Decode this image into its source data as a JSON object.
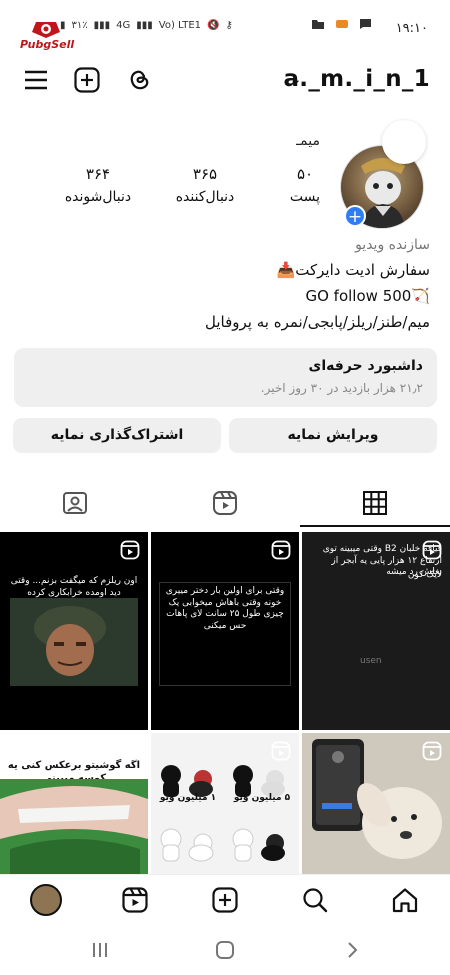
{
  "status_bar": {
    "time": "۱۹:۱۰",
    "battery": "۳۱٪",
    "network": "4G",
    "volte": "Vo) LTE1",
    "logo_text": "PubgSell"
  },
  "header": {
    "username": "a._m._i_n_1"
  },
  "profile": {
    "display_name": "میمـ",
    "stats": [
      {
        "value": "۵۰",
        "label": "پست"
      },
      {
        "value": "۳۶۵",
        "label": "دنبال‌کننده"
      },
      {
        "value": "۳۶۴",
        "label": "دنبال‌شونده"
      }
    ],
    "category": "سازنده ویدیو",
    "bio_lines": [
      "سفارش ادیت دایرکت📥",
      "GO follow 500🏹",
      "میم/طنز/ریلز/پابجی/نمره به پروفایل"
    ]
  },
  "dashboard": {
    "title": "داشبورد حرفه‌ای",
    "subtitle": "۲۱٫۲ هزار بازدید در ۳۰ روز اخیر."
  },
  "buttons": {
    "edit": "ویرایش نمایه",
    "share": "اشتراک‌گذاری نمایه"
  },
  "tiles": [
    {
      "text": "اون ریلزم که میگفت بزنم... وقتی دید اومده خرابکاری کرده"
    },
    {
      "text": "وقتی برای اولین بار دختر مییری خونه وقتی باهاش میخوابی یک چیزی طول ۲۵ سانت لای پاهات حس میکنی"
    },
    {
      "text": "قیافه خلبان B2 وقتی میبینه توی ارتفاع ۱۲ هزار پایی یه آبجر از بغلش رد میشه",
      "sub": "لایک کون",
      "extra": "usen"
    },
    {
      "text": "اگه گوشیتو برعکس کنی یه کوسه میبینی"
    },
    {
      "labels": [
        "۱ میلیون ویو",
        "۵ میلیون ویو"
      ]
    },
    {
      "text": ""
    }
  ]
}
